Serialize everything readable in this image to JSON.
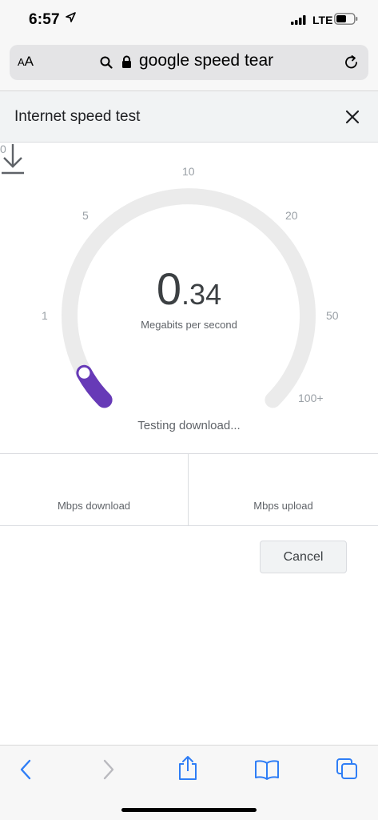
{
  "status_bar": {
    "time": "6:57",
    "network": "LTE",
    "icons": [
      "location-arrow-icon",
      "signal-icon",
      "battery-icon"
    ]
  },
  "browser": {
    "text_size_label_small": "A",
    "text_size_label_large": "A",
    "url": "google speed tear",
    "icons": [
      "search-icon",
      "lock-icon",
      "reload-icon"
    ]
  },
  "panel": {
    "title": "Internet speed test",
    "close_icon": "close-icon"
  },
  "gauge": {
    "ticks": [
      "0",
      "1",
      "5",
      "10",
      "20",
      "50",
      "100+"
    ],
    "speed_integer": "0",
    "speed_fraction": ".34",
    "unit": "Megabits per second",
    "status": "Testing download...",
    "needle_fraction": 0.06,
    "accent_color": "#673ab7",
    "track_color": "#ebebeb"
  },
  "results": {
    "download_label": "Mbps download",
    "upload_label": "Mbps upload"
  },
  "actions": {
    "cancel_label": "Cancel"
  },
  "toolbar": {
    "icons": [
      "back-icon",
      "forward-icon",
      "share-icon",
      "bookmarks-icon",
      "tabs-icon"
    ],
    "accent_color": "#2f7ef6"
  }
}
